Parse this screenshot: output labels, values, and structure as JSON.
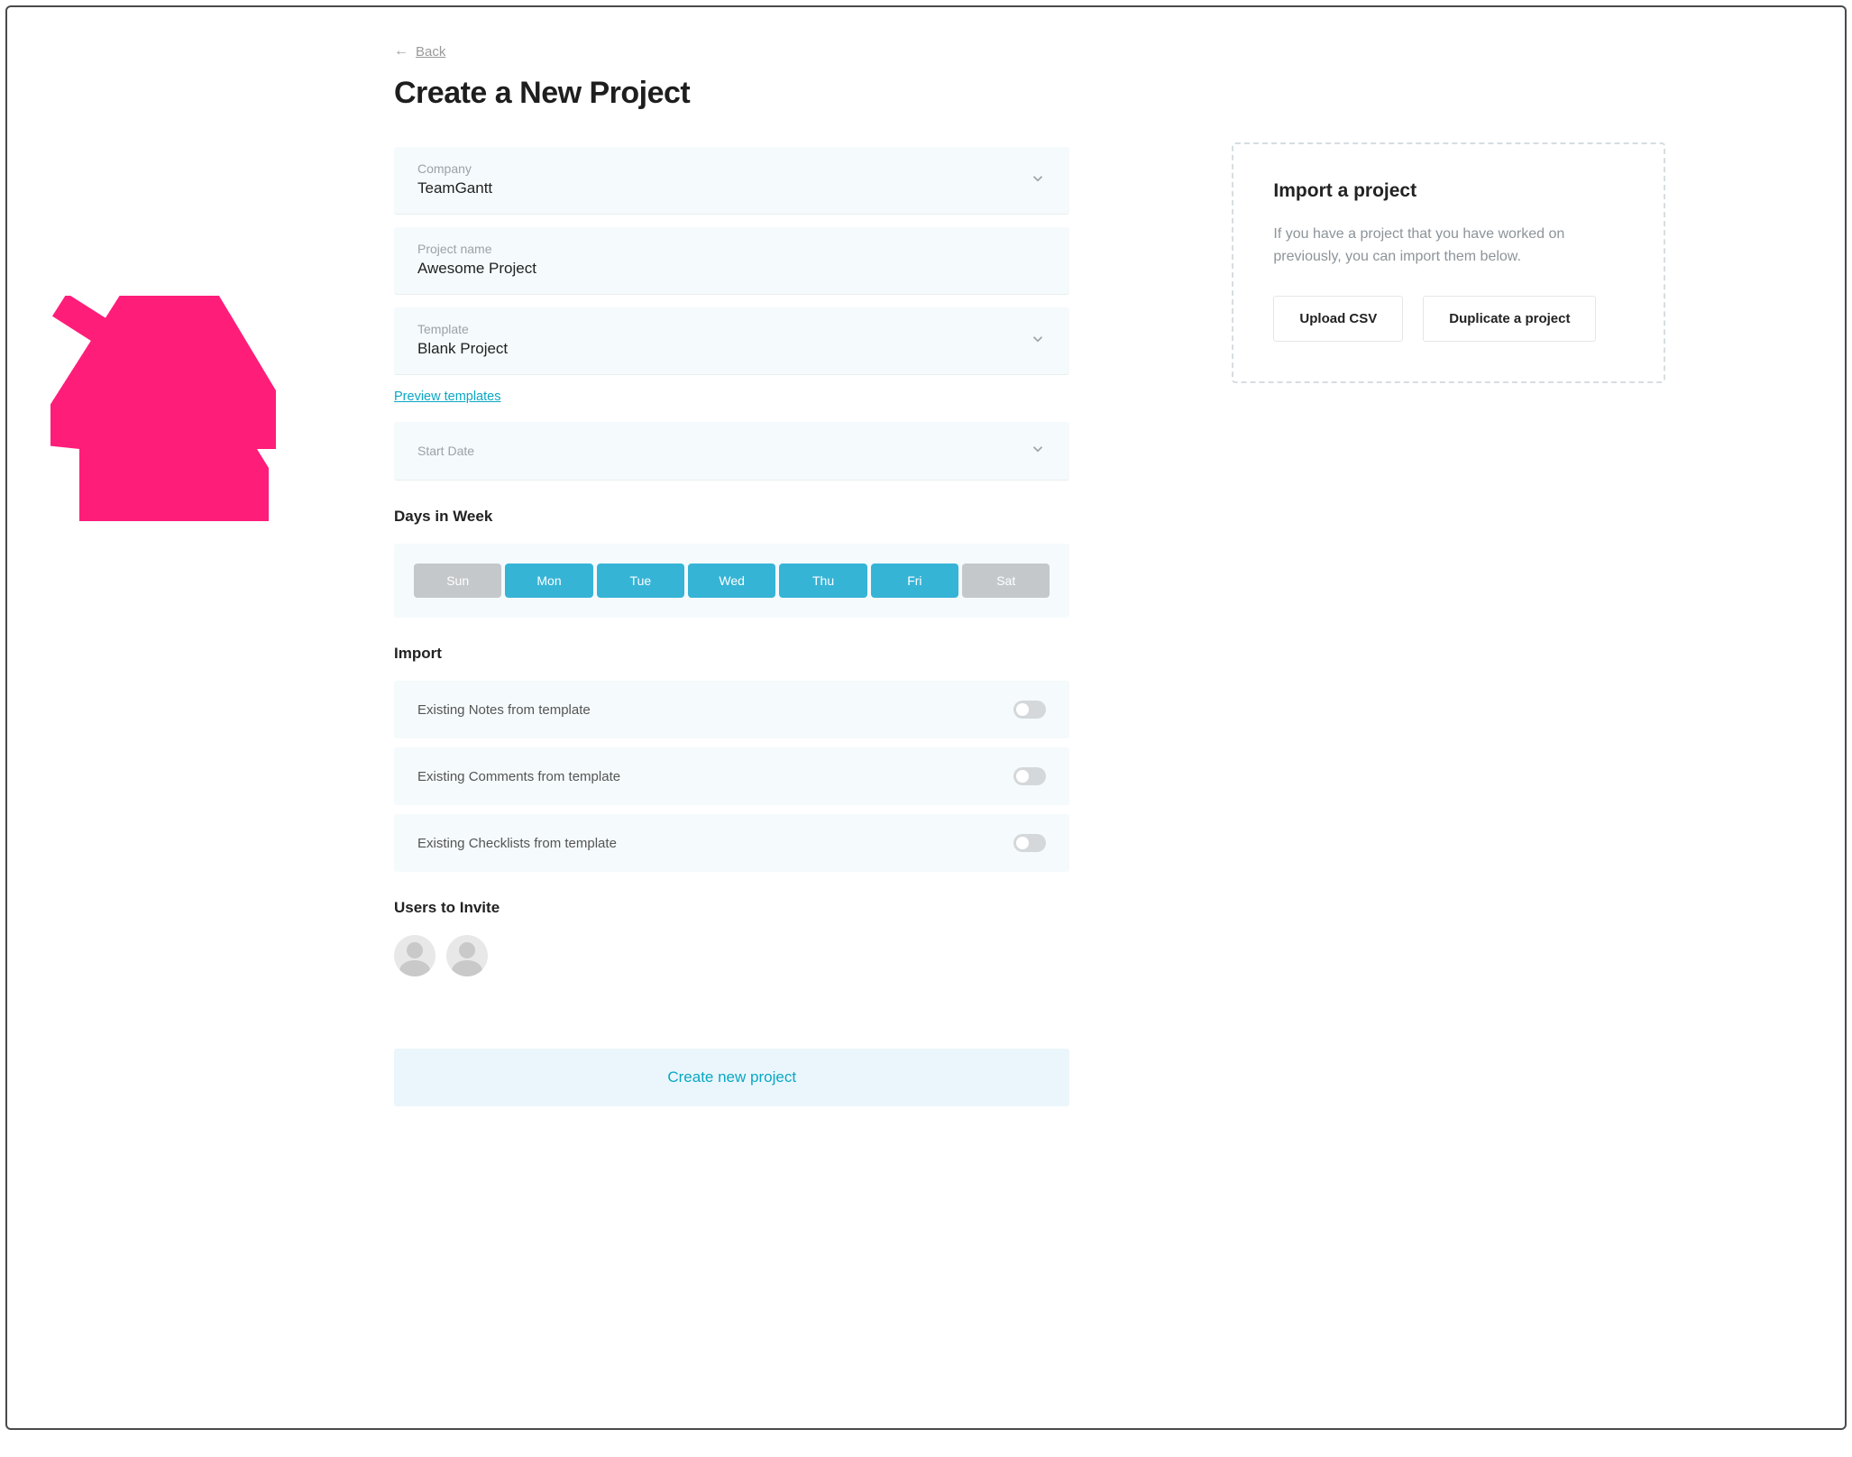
{
  "back": {
    "label": "Back"
  },
  "page": {
    "title": "Create a New Project"
  },
  "fields": {
    "company": {
      "label": "Company",
      "value": "TeamGantt"
    },
    "project": {
      "label": "Project name",
      "value": "Awesome Project"
    },
    "template": {
      "label": "Template",
      "value": "Blank Project"
    },
    "start_date": {
      "label": "Start Date",
      "value": ""
    }
  },
  "preview_templates_label": "Preview templates",
  "days_in_week": {
    "heading": "Days in Week",
    "days": [
      {
        "short": "Sun",
        "active": false
      },
      {
        "short": "Mon",
        "active": true
      },
      {
        "short": "Tue",
        "active": true
      },
      {
        "short": "Wed",
        "active": true
      },
      {
        "short": "Thu",
        "active": true
      },
      {
        "short": "Fri",
        "active": true
      },
      {
        "short": "Sat",
        "active": false
      }
    ]
  },
  "import_section": {
    "heading": "Import",
    "toggles": [
      {
        "label": "Existing Notes from template",
        "on": false
      },
      {
        "label": "Existing Comments from template",
        "on": false
      },
      {
        "label": "Existing Checklists from template",
        "on": false
      }
    ]
  },
  "users": {
    "heading": "Users to Invite",
    "count": 2
  },
  "create_button_label": "Create new project",
  "import_card": {
    "title": "Import a project",
    "description": "If you have a project that you have worked on previously, you can import them below.",
    "upload_label": "Upload CSV",
    "duplicate_label": "Duplicate a project"
  }
}
